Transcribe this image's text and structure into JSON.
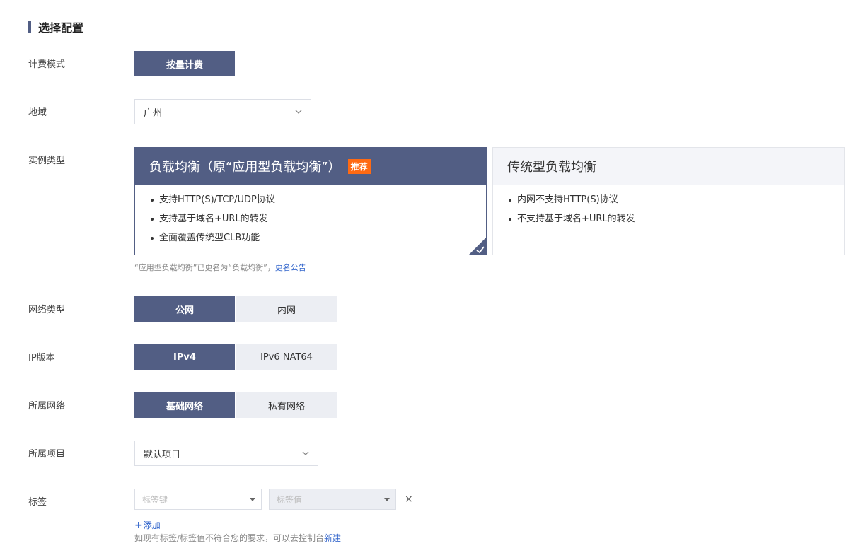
{
  "section": {
    "title": "选择配置"
  },
  "billing": {
    "label": "计费模式",
    "options": [
      "按量计费"
    ]
  },
  "region": {
    "label": "地域",
    "value": "广州"
  },
  "instance": {
    "label": "实例类型",
    "cards": [
      {
        "title": "负载均衡（原“应用型负载均衡”）",
        "badge": "推荐",
        "features": [
          "支持HTTP(S)/TCP/UDP协议",
          "支持基于域名+URL的转发",
          "全面覆盖传统型CLB功能"
        ]
      },
      {
        "title": "传统型负载均衡",
        "features": [
          "内网不支持HTTP(S)协议",
          "不支持基于域名+URL的转发"
        ]
      }
    ],
    "note": "“应用型负载均衡”已更名为“负载均衡”，",
    "note_link": "更名公告"
  },
  "network_type": {
    "label": "网络类型",
    "options": [
      "公网",
      "内网"
    ]
  },
  "ip_version": {
    "label": "IP版本",
    "options": [
      "IPv4",
      "IPv6 NAT64"
    ]
  },
  "vpc": {
    "label": "所属网络",
    "options": [
      "基础网络",
      "私有网络"
    ]
  },
  "project": {
    "label": "所属项目",
    "value": "默认项目"
  },
  "tags": {
    "label": "标签",
    "key_placeholder": "标签键",
    "value_placeholder": "标签值",
    "remove_symbol": "×",
    "add_label": "添加",
    "hint": "如现有标签/标签值不符合您的要求，可以去控制台",
    "hint_link": "新建"
  },
  "colors": {
    "primary": "#525e84",
    "badge": "#ff6a13",
    "link": "#3366cc"
  }
}
